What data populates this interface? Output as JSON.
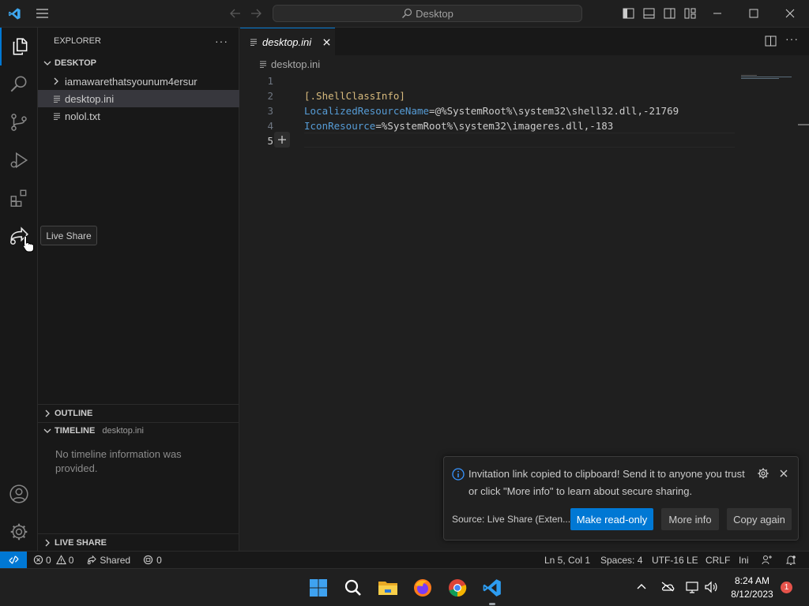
{
  "window": {
    "search_text": "Desktop"
  },
  "sidebar": {
    "title": "EXPLORER",
    "folder": "DESKTOP",
    "items": [
      {
        "label": "iamawarethatsyounum4ersur",
        "type": "folder"
      },
      {
        "label": "desktop.ini",
        "type": "file",
        "selected": true
      },
      {
        "label": "nolol.txt",
        "type": "file"
      }
    ],
    "outline_label": "OUTLINE",
    "timeline_label": "TIMELINE",
    "timeline_file": "desktop.ini",
    "timeline_empty": "No timeline information was provided.",
    "liveshare_label": "LIVE SHARE"
  },
  "tooltip": "Live Share",
  "editor": {
    "tab_label": "desktop.ini",
    "breadcrumb": "desktop.ini",
    "lines": [
      {
        "num": "1",
        "parts": []
      },
      {
        "num": "2",
        "parts": [
          {
            "t": "[.ShellClassInfo]",
            "c": "#d7ba7d"
          }
        ]
      },
      {
        "num": "3",
        "parts": [
          {
            "t": "LocalizedResourceName",
            "c": "#569cd6"
          },
          {
            "t": "=@%SystemRoot%\\system32\\shell32.dll,-21769",
            "c": "#cccccc"
          }
        ]
      },
      {
        "num": "4",
        "parts": [
          {
            "t": "IconResource",
            "c": "#569cd6"
          },
          {
            "t": "=%SystemRoot%\\system32\\imageres.dll,-183",
            "c": "#cccccc"
          }
        ]
      },
      {
        "num": "5",
        "parts": []
      }
    ]
  },
  "notification": {
    "line1": "Invitation link copied to clipboard! Send it to anyone you trust",
    "line2": "or click \"More info\" to learn about secure sharing.",
    "source": "Source: Live Share (Exten...",
    "btn_primary": "Make read-only",
    "btn_more": "More info",
    "btn_copy": "Copy again"
  },
  "statusbar": {
    "errors": "0",
    "warnings": "0",
    "shared": "Shared",
    "ports": "0",
    "position": "Ln 5, Col 1",
    "spaces": "Spaces: 4",
    "encoding": "UTF-16 LE",
    "eol": "CRLF",
    "language": "Ini"
  },
  "taskbar": {
    "time": "8:24 AM",
    "date": "8/12/2023",
    "badge": "1"
  },
  "colors": {
    "accent": "#0078d4",
    "remote": "#0078d4",
    "keyword": "#569cd6",
    "section": "#d7ba7d"
  }
}
